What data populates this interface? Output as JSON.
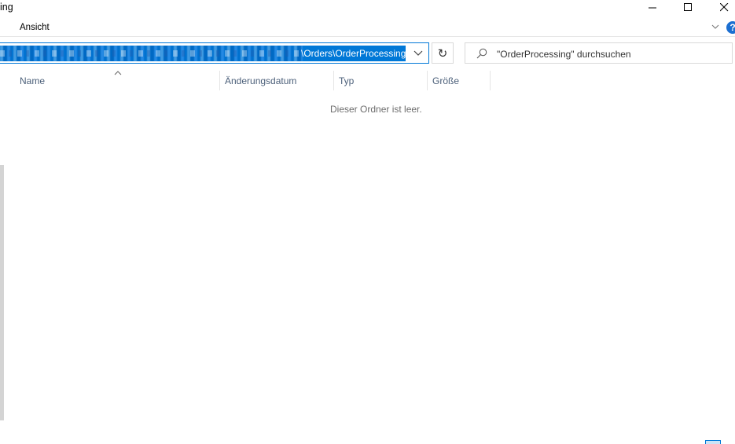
{
  "window": {
    "title_fragment": "ing",
    "controls": [
      "minimize-icon",
      "maximize-icon",
      "close-icon"
    ]
  },
  "ribbon": {
    "tab_label": "Ansicht",
    "expand_icon": "chevron-down-icon",
    "help_label": "?"
  },
  "address_bar": {
    "path_visible": "\\Orders\\OrderProcessing",
    "dropdown_icon": "chevron-down-icon"
  },
  "refresh": {
    "icon": "refresh-icon",
    "glyph": "↻"
  },
  "search": {
    "placeholder": "\"OrderProcessing\" durchsuchen",
    "icon": "search-icon"
  },
  "columns": [
    {
      "label": "Name"
    },
    {
      "label": "Änderungsdatum"
    },
    {
      "label": "Typ"
    },
    {
      "label": "Größe"
    }
  ],
  "empty_message": "Dieser Ordner ist leer.",
  "colors": {
    "accent": "#0078d7",
    "header_text": "#4c607a"
  }
}
